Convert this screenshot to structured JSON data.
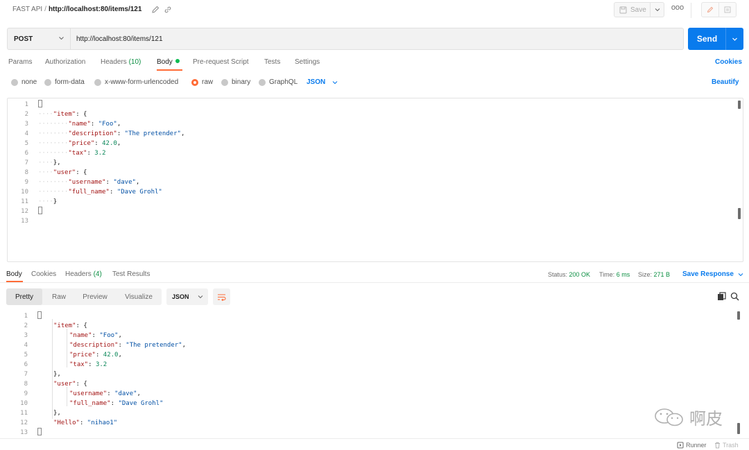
{
  "title": {
    "collection": "FAST API",
    "separator": "/",
    "request_name": "http://localhost:80/items/121",
    "save_label": "Save",
    "more_label": "ooo"
  },
  "request": {
    "method": "POST",
    "url": "http://localhost:80/items/121",
    "send_label": "Send"
  },
  "request_tabs": {
    "params": "Params",
    "authorization": "Authorization",
    "headers": "Headers",
    "headers_count": "(10)",
    "body": "Body",
    "pre_request": "Pre-request Script",
    "tests": "Tests",
    "settings": "Settings",
    "cookies": "Cookies"
  },
  "body_types": {
    "none": "none",
    "form_data": "form-data",
    "urlencoded": "x-www-form-urlencoded",
    "raw": "raw",
    "binary": "binary",
    "graphql": "GraphQL",
    "format": "JSON",
    "beautify": "Beautify",
    "selected": "raw"
  },
  "request_body_lines": [
    {
      "num": "1"
    },
    {
      "num": "2"
    },
    {
      "num": "3"
    },
    {
      "num": "4"
    },
    {
      "num": "5"
    },
    {
      "num": "6"
    },
    {
      "num": "7"
    },
    {
      "num": "8"
    },
    {
      "num": "9"
    },
    {
      "num": "10"
    },
    {
      "num": "11"
    },
    {
      "num": "12"
    },
    {
      "num": "13"
    }
  ],
  "request_json": {
    "item_key": "\"item\"",
    "name_key": "\"name\"",
    "name_val": "\"Foo\"",
    "desc_key": "\"description\"",
    "desc_val": "\"The pretender\"",
    "price_key": "\"price\"",
    "price_val": "42.0",
    "tax_key": "\"tax\"",
    "tax_val": "3.2",
    "user_key": "\"user\"",
    "username_key": "\"username\"",
    "username_val": "\"dave\"",
    "fullname_key": "\"full_name\"",
    "fullname_val": "\"Dave Grohl\""
  },
  "response_tabs": {
    "body": "Body",
    "cookies": "Cookies",
    "headers": "Headers",
    "headers_count": "(4)",
    "test_results": "Test Results"
  },
  "response_meta": {
    "status_label": "Status:",
    "status_value": "200 OK",
    "time_label": "Time:",
    "time_value": "6 ms",
    "size_label": "Size:",
    "size_value": "271 B",
    "save_response": "Save Response"
  },
  "response_view": {
    "pretty": "Pretty",
    "raw": "Raw",
    "preview": "Preview",
    "visualize": "Visualize",
    "format": "JSON",
    "selected": "Pretty"
  },
  "response_json": {
    "hello_key": "\"Hello\"",
    "hello_val": "\"nihao1\""
  },
  "watermark": {
    "text": "啊皮"
  },
  "statusbar": {
    "runner": "Runner",
    "trash": "Trash"
  },
  "colors": {
    "accent": "#ff6c37",
    "primary": "#097bed",
    "success": "#0c8f43"
  }
}
